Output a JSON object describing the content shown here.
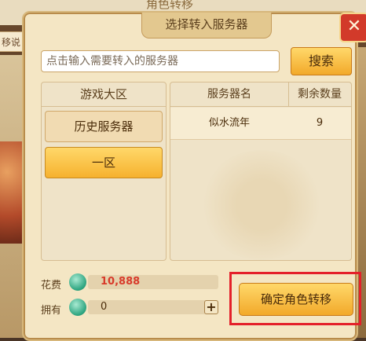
{
  "background": {
    "panel_title": "角色转移",
    "side_tab": "移说"
  },
  "dialog": {
    "title": "选择转入服务器",
    "close_icon": "close-icon"
  },
  "search": {
    "placeholder": "点击输入需要转入的服务器",
    "button_label": "搜索"
  },
  "zones": {
    "header": "游戏大区",
    "items": [
      {
        "label": "历史服务器",
        "active": false
      },
      {
        "label": "一区",
        "active": true
      }
    ]
  },
  "servers": {
    "columns": [
      "服务器名",
      "剩余数量"
    ],
    "rows": [
      {
        "name": "似水流年",
        "count": "9"
      }
    ]
  },
  "cost": {
    "label": "花费",
    "value": "10,888",
    "icon": "jade-coin-icon"
  },
  "owned": {
    "label": "拥有",
    "value": "0",
    "icon": "jade-coin-icon"
  },
  "confirm": {
    "label": "确定角色转移"
  },
  "colors": {
    "accent_gold": "#f2a92a",
    "cost_red": "#d83a2a",
    "highlight_red": "#e4202a",
    "close_red": "#d23a2a"
  }
}
